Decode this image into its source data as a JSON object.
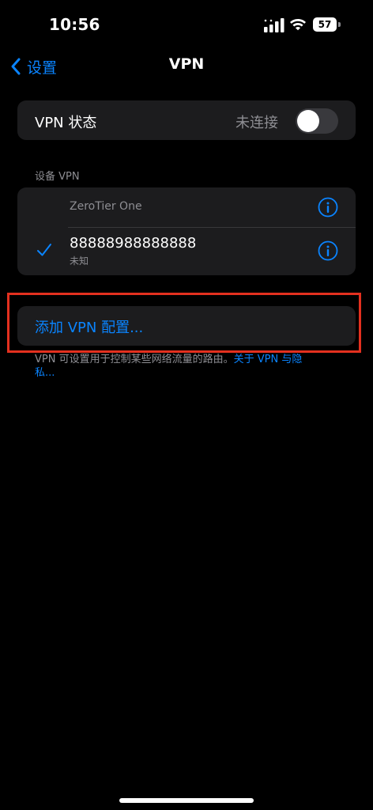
{
  "status_bar": {
    "time": "10:56",
    "battery_level": "57",
    "icons": [
      "signal-icon",
      "wifi-icon",
      "battery-icon"
    ]
  },
  "nav": {
    "back_label": "设置",
    "title": "VPN"
  },
  "vpn_status": {
    "label": "VPN 状态",
    "value": "未连接",
    "toggle_on": false
  },
  "devices": {
    "header": "设备 VPN",
    "items": [
      {
        "name": "ZeroTier One",
        "subtitle": "",
        "selected": false
      },
      {
        "name": "88888988888888",
        "subtitle": "未知",
        "selected": true
      }
    ]
  },
  "add_config": {
    "label": "添加 VPN 配置..."
  },
  "footer": {
    "text": "VPN 可设置用于控制某些网络流量的路由。",
    "link": "关于 VPN 与隐私..."
  },
  "colors": {
    "accent": "#0a84ff",
    "background": "#000000",
    "group_background": "#1c1c1e",
    "secondary_text": "#8e8e93",
    "highlight_box": "#e3301f"
  }
}
